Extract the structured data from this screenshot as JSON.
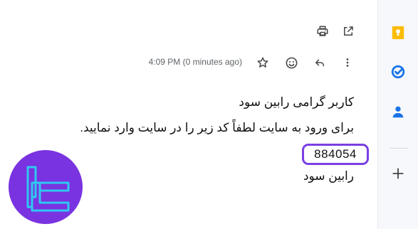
{
  "toolbar": {
    "print_icon": "print-icon",
    "open_new_window_icon": "open-in-new-window-icon"
  },
  "message": {
    "time": "4:09 PM (0 minutes ago)",
    "star_icon": "star-outline-icon",
    "emoji_icon": "emoji-reaction-icon",
    "reply_icon": "reply-icon",
    "more_icon": "more-vertical-icon",
    "greeting": "کاربر گرامی رابین سود",
    "instruction": "برای ورود به سایت لطفاً کد زیر را در سایت وارد نمایید.",
    "code": "884054",
    "signature": "رابین سود"
  },
  "side_panel": {
    "apps": [
      {
        "name": "keep-icon",
        "color": "#fbbc04"
      },
      {
        "name": "tasks-icon",
        "color": "#1a73e8"
      },
      {
        "name": "contacts-icon",
        "color": "#1a73e8"
      }
    ],
    "add_icon": "add-icon"
  },
  "colors": {
    "highlight": "#7b3fe4",
    "logo_bg": "#7a33e0",
    "logo_mark": "#2ec9f0"
  }
}
